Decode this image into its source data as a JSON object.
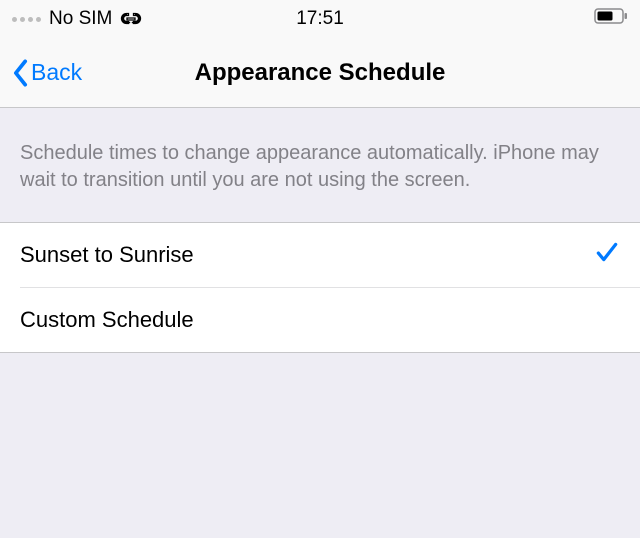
{
  "status": {
    "carrier": "No SIM",
    "time": "17:51"
  },
  "nav": {
    "back_label": "Back",
    "title": "Appearance Schedule"
  },
  "section": {
    "description": "Schedule times to change appearance automatically. iPhone may wait to transition until you are not using the screen."
  },
  "options": {
    "sunset_label": "Sunset to Sunrise",
    "custom_label": "Custom Schedule",
    "selected": "sunset"
  }
}
